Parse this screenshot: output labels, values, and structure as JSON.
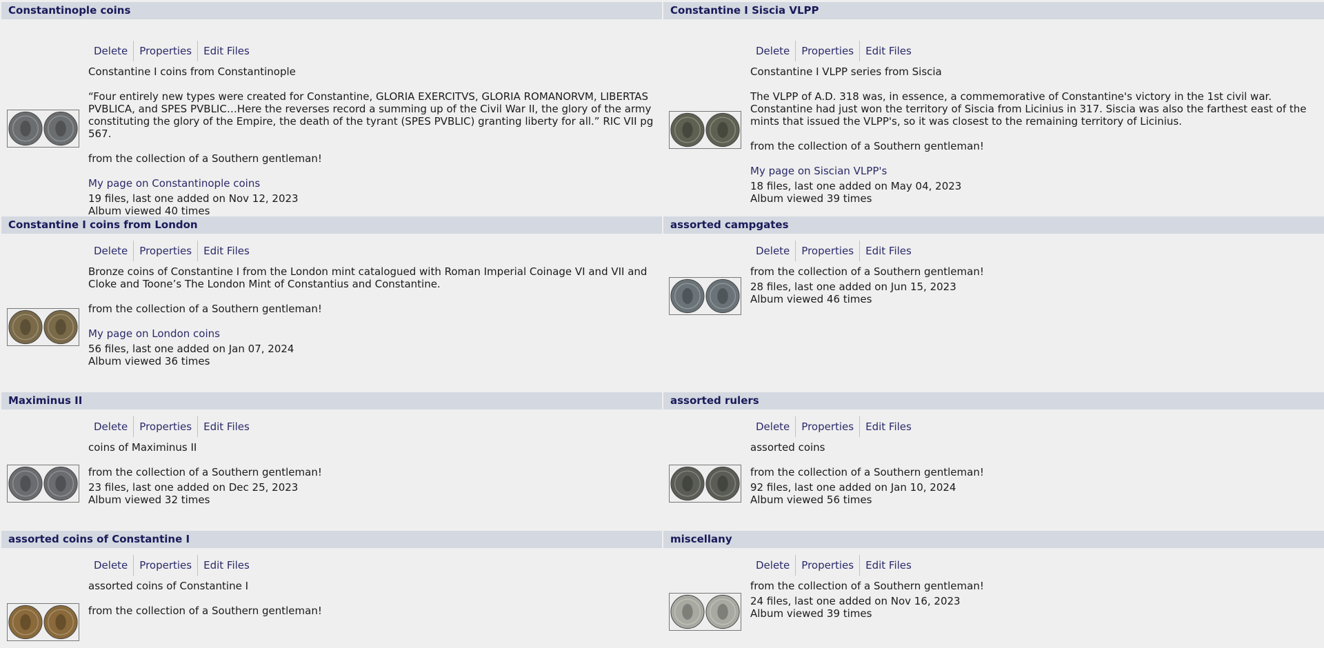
{
  "common": {
    "delete": "Delete",
    "properties": "Properties",
    "edit_files": "Edit Files"
  },
  "albums": [
    {
      "title": "Constantinople coins",
      "paragraphs": [
        "Constantine I coins from Constantinople",
        "“Four entirely new types were created for Constantine, GLORIA EXERCITVS, GLORIA ROMANORVM, LIBERTAS PVBLICA, and SPES PVBLIC…Here the reverses record a summing up of the Civil War II, the glory of the army constituting the glory of the Empire, the death of the tyrant (SPES PVBLIC) granting liberty for all.” RIC VII pg 567.",
        "from the collection of a Southern gentleman!"
      ],
      "link": "My page on Constantinople coins",
      "files": "19 files, last one added on Nov 12, 2023",
      "views": "Album viewed 40 times"
    },
    {
      "title": "Constantine I Siscia VLPP",
      "paragraphs": [
        "Constantine I VLPP series from Siscia",
        "The VLPP of A.D. 318 was, in essence, a commemorative of Constantine's victory in the 1st civil war. Constantine had just won the territory of Siscia from Licinius in 317. Siscia was also the farthest east of the mints that issued the VLPP's, so it was closest to the remaining territory of Licinius.",
        "from the collection of a Southern gentleman!"
      ],
      "link": "My page on Siscian VLPP's",
      "files": "18 files, last one added on May 04, 2023",
      "views": "Album viewed 39 times"
    },
    {
      "title": "Constantine I coins from London",
      "paragraphs": [
        "Bronze coins of Constantine I from the London mint catalogued with Roman Imperial Coinage VI and VII and Cloke and Toone’s The London Mint of Constantius and Constantine.",
        "from the collection of a Southern gentleman!"
      ],
      "link": "My page on London coins",
      "files": "56 files, last one added on Jan 07, 2024",
      "views": "Album viewed 36 times"
    },
    {
      "title": "assorted campgates",
      "paragraphs": [
        "from the collection of a Southern gentleman!"
      ],
      "link": "",
      "files": "28 files, last one added on Jun 15, 2023",
      "views": "Album viewed 46 times"
    },
    {
      "title": "Maximinus II",
      "paragraphs": [
        "coins of Maximinus II",
        "from the collection of a Southern gentleman!"
      ],
      "link": "",
      "files": "23 files, last one added on Dec 25, 2023",
      "views": "Album viewed 32 times"
    },
    {
      "title": "assorted rulers",
      "paragraphs": [
        "assorted coins",
        "from the collection of a Southern gentleman!"
      ],
      "link": "",
      "files": "92 files, last one added on Jan 10, 2024",
      "views": "Album viewed 56 times"
    },
    {
      "title": "assorted coins of Constantine I",
      "paragraphs": [
        "assorted coins of Constantine I",
        "from the collection of a Southern gentleman!"
      ],
      "link": "",
      "files": "",
      "views": ""
    },
    {
      "title": "miscellany",
      "paragraphs": [
        "from the collection of a Southern gentleman!"
      ],
      "link": "",
      "files": "24 files, last one added on Nov 16, 2023",
      "views": "Album viewed 39 times"
    }
  ],
  "thumb_colors": [
    "#6b6e70",
    "#5e6152",
    "#7a6a48",
    "#6a7378",
    "#6a6c70",
    "#5a5c55",
    "#8a6a3a",
    "#a8aaa2"
  ]
}
